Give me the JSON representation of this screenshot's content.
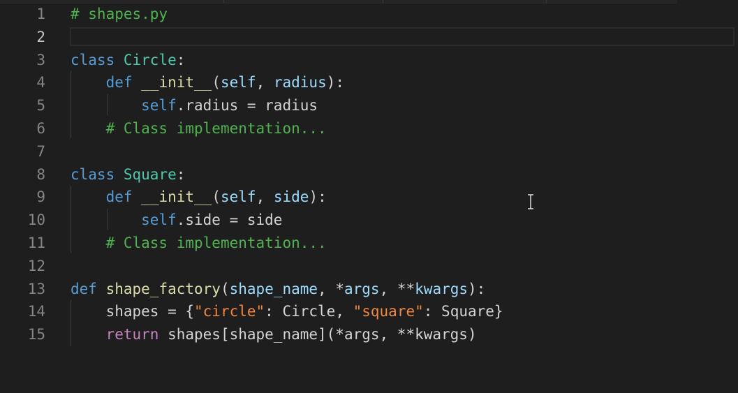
{
  "editor": {
    "language": "python",
    "current_line": 2,
    "lines": [
      {
        "n": "1",
        "tokens": [
          {
            "t": "# shapes.py",
            "c": "t-comment-bright"
          }
        ]
      },
      {
        "n": "2",
        "tokens": []
      },
      {
        "n": "3",
        "tokens": [
          {
            "t": "class",
            "c": "t-kw"
          },
          {
            "t": " ",
            "c": "t-plain"
          },
          {
            "t": "Circle",
            "c": "t-cls"
          },
          {
            "t": ":",
            "c": "t-plain"
          }
        ]
      },
      {
        "n": "4",
        "tokens": [
          {
            "t": "    ",
            "c": "t-plain"
          },
          {
            "t": "def",
            "c": "t-kw"
          },
          {
            "t": " ",
            "c": "t-plain"
          },
          {
            "t": "__init__",
            "c": "t-fn"
          },
          {
            "t": "(",
            "c": "t-plain"
          },
          {
            "t": "self",
            "c": "t-param"
          },
          {
            "t": ", ",
            "c": "t-plain"
          },
          {
            "t": "radius",
            "c": "t-param"
          },
          {
            "t": "):",
            "c": "t-plain"
          }
        ]
      },
      {
        "n": "5",
        "tokens": [
          {
            "t": "        ",
            "c": "t-plain"
          },
          {
            "t": "self",
            "c": "t-kw"
          },
          {
            "t": ".radius = radius",
            "c": "t-plain"
          }
        ]
      },
      {
        "n": "6",
        "tokens": [
          {
            "t": "    ",
            "c": "t-plain"
          },
          {
            "t": "# Class implementation...",
            "c": "t-comment-bright"
          }
        ]
      },
      {
        "n": "7",
        "tokens": []
      },
      {
        "n": "8",
        "tokens": [
          {
            "t": "class",
            "c": "t-kw"
          },
          {
            "t": " ",
            "c": "t-plain"
          },
          {
            "t": "Square",
            "c": "t-cls"
          },
          {
            "t": ":",
            "c": "t-plain"
          }
        ]
      },
      {
        "n": "9",
        "tokens": [
          {
            "t": "    ",
            "c": "t-plain"
          },
          {
            "t": "def",
            "c": "t-kw"
          },
          {
            "t": " ",
            "c": "t-plain"
          },
          {
            "t": "__init__",
            "c": "t-fn"
          },
          {
            "t": "(",
            "c": "t-plain"
          },
          {
            "t": "self",
            "c": "t-param"
          },
          {
            "t": ", ",
            "c": "t-plain"
          },
          {
            "t": "side",
            "c": "t-param"
          },
          {
            "t": "):",
            "c": "t-plain"
          }
        ]
      },
      {
        "n": "10",
        "tokens": [
          {
            "t": "        ",
            "c": "t-plain"
          },
          {
            "t": "self",
            "c": "t-kw"
          },
          {
            "t": ".side = side",
            "c": "t-plain"
          }
        ]
      },
      {
        "n": "11",
        "tokens": [
          {
            "t": "    ",
            "c": "t-plain"
          },
          {
            "t": "# Class implementation...",
            "c": "t-comment-bright"
          }
        ]
      },
      {
        "n": "12",
        "tokens": []
      },
      {
        "n": "13",
        "tokens": [
          {
            "t": "def",
            "c": "t-kw"
          },
          {
            "t": " ",
            "c": "t-plain"
          },
          {
            "t": "shape_factory",
            "c": "t-fn"
          },
          {
            "t": "(",
            "c": "t-plain"
          },
          {
            "t": "shape_name",
            "c": "t-param"
          },
          {
            "t": ", *",
            "c": "t-plain"
          },
          {
            "t": "args",
            "c": "t-param"
          },
          {
            "t": ", **",
            "c": "t-plain"
          },
          {
            "t": "kwargs",
            "c": "t-param"
          },
          {
            "t": "):",
            "c": "t-plain"
          }
        ]
      },
      {
        "n": "14",
        "tokens": [
          {
            "t": "    shapes = {",
            "c": "t-plain"
          },
          {
            "t": "\"circle\"",
            "c": "t-str2"
          },
          {
            "t": ": Circle, ",
            "c": "t-plain"
          },
          {
            "t": "\"square\"",
            "c": "t-str2"
          },
          {
            "t": ": Square}",
            "c": "t-plain"
          }
        ]
      },
      {
        "n": "15",
        "tokens": [
          {
            "t": "    ",
            "c": "t-plain"
          },
          {
            "t": "return",
            "c": "t-ctrl"
          },
          {
            "t": " shapes[shape_name](*args, **kwargs)",
            "c": "t-plain"
          }
        ]
      }
    ]
  },
  "icons": {
    "mouse_cursor": "text-cursor-icon"
  },
  "colors": {
    "background": "#1e1e1e",
    "line_number": "#858585",
    "keyword": "#569cd6",
    "class_name": "#4ec9b0",
    "function": "#dcdcaa",
    "parameter": "#9cdcfe",
    "string": "#f0883e",
    "comment": "#4fb34f",
    "control": "#c586c0"
  }
}
